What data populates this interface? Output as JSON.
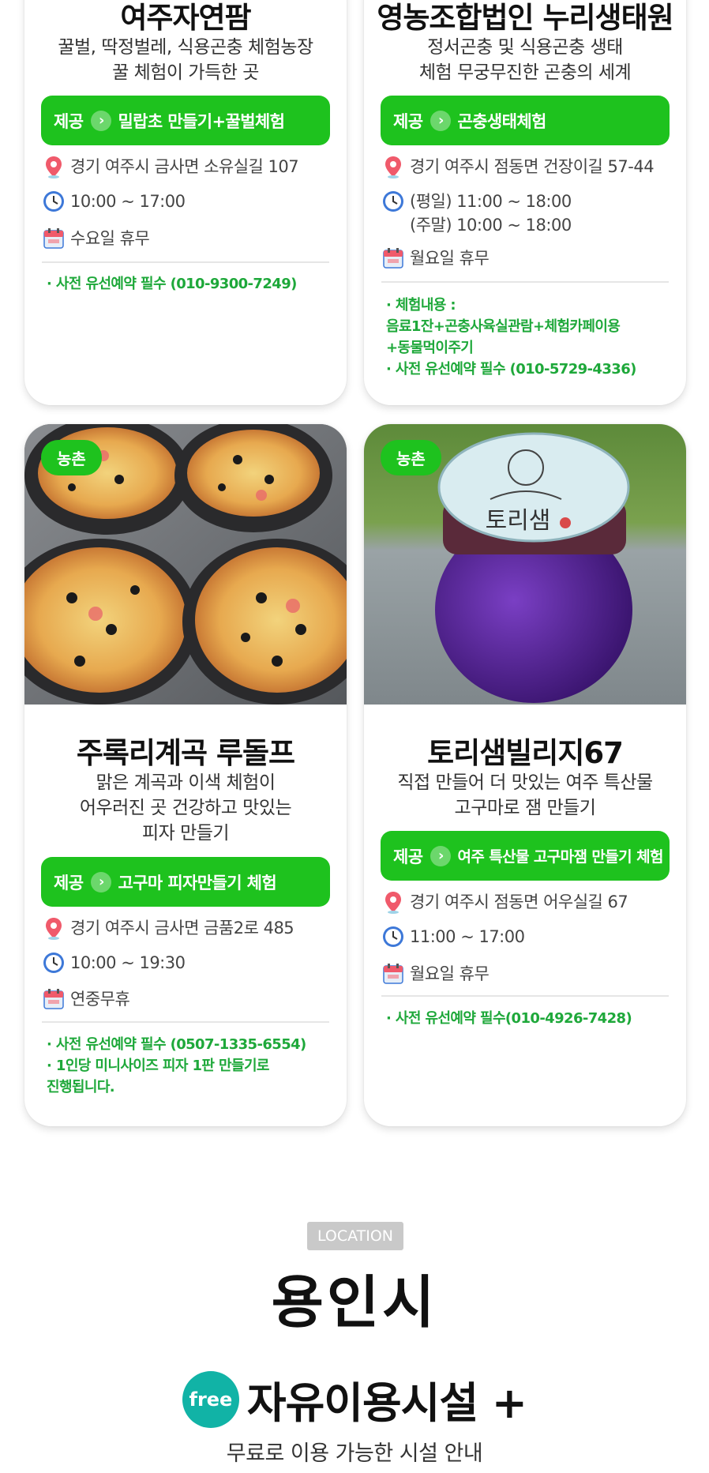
{
  "cards": [
    {
      "title": "여주자연팜",
      "desc": [
        "꿀벌, 딱정벌레, 식용곤충 체험농장",
        "꿀 체험이 가득한 곳"
      ],
      "offer_prefix": "제공",
      "offer": "밀랍초 만들기+꿀벌체험",
      "address": "경기 여주시 금사면 소유실길 107",
      "hours": [
        "10:00 ~ 17:00"
      ],
      "closed": "수요일 휴무",
      "notes": [
        "· 사전 유선예약 필수 (010-9300-7249)"
      ]
    },
    {
      "title": "영농조합법인 누리생태원",
      "desc": [
        "정서곤충 및 식용곤충 생태",
        "체험 무궁무진한 곤충의 세계"
      ],
      "offer_prefix": "제공",
      "offer": "곤충생태체험",
      "address": "경기 여주시 점동면 건장이길 57-44",
      "hours": [
        "(평일) 11:00 ~ 18:00",
        "(주말) 10:00 ~ 18:00"
      ],
      "closed": "월요일 휴무",
      "notes": [
        "· 체험내용 :",
        " 음료1잔+곤충사육실관람+체험카페이용",
        "+동물먹이주기",
        "· 사전 유선예약 필수 (010-5729-4336)"
      ]
    },
    {
      "tag": "농촌",
      "title": "주록리계곡 루돌프",
      "desc": [
        "맑은 계곡과 이색 체험이",
        "어우러진 곳 건강하고 맛있는",
        "피자 만들기"
      ],
      "offer_prefix": "제공",
      "offer": "고구마 피자만들기 체험",
      "address": "경기 여주시 금사면 금품2로 485",
      "hours": [
        "10:00 ~ 19:30"
      ],
      "closed": "연중무휴",
      "notes": [
        "· 사전 유선예약 필수 (0507-1335-6554)",
        "· 1인당 미니사이즈 피자 1판 만들기로",
        "  진행됩니다."
      ]
    },
    {
      "tag": "농촌",
      "title": "토리샘빌리지67",
      "desc": [
        "직접 만들어 더 맛있는 여주 특산물",
        "고구마로 잼 만들기"
      ],
      "offer_prefix": "제공",
      "offer": "여주 특산물 고구마잼 만들기 체험",
      "address": "경기 여주시 점동면 어우실길 67",
      "hours": [
        "11:00 ~ 17:00"
      ],
      "closed": "월요일 휴무",
      "notes": [
        "· 사전 유선예약 필수(010-4926-7428)"
      ],
      "jar_label": "토리샘"
    }
  ],
  "location": {
    "badge": "LOCATION",
    "city": "용인시",
    "free_badge": "free",
    "free_title": "자유이용시설 +",
    "free_sub": "무료로 이용 가능한 시설 안내"
  },
  "icons": {
    "address": "map-pin-icon",
    "hours": "clock-icon",
    "closed": "calendar-icon",
    "chevron": "chevron-right-icon"
  },
  "colors": {
    "accent_green": "#1ec21e",
    "note_green": "#1ea83a",
    "free_teal": "#11b3a6",
    "badge_gray": "#c9c9c9"
  }
}
